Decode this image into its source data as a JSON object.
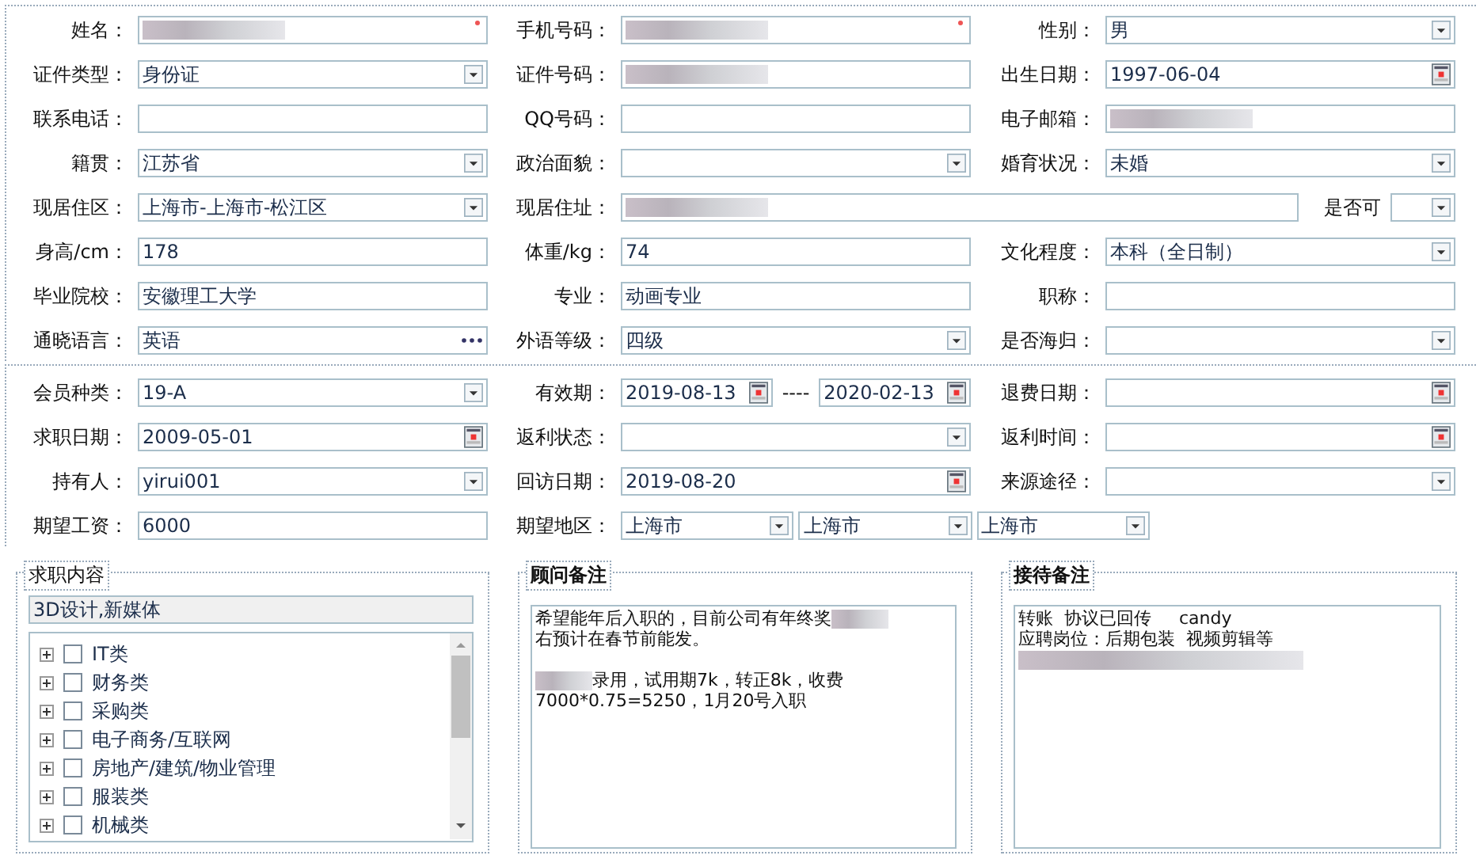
{
  "basic_rows": [
    {
      "kind": "triple",
      "items": [
        {
          "label": "姓名：",
          "controls": [
            {
              "kind": "text",
              "redacted": true,
              "required": true
            }
          ]
        },
        {
          "label": "手机号码：",
          "controls": [
            {
              "kind": "text",
              "redacted": true,
              "required": true
            }
          ]
        },
        {
          "label": "性别：",
          "controls": [
            {
              "kind": "select",
              "value": "男"
            }
          ]
        }
      ]
    },
    {
      "kind": "triple",
      "items": [
        {
          "label": "证件类型：",
          "controls": [
            {
              "kind": "select",
              "value": "身份证"
            }
          ]
        },
        {
          "label": "证件号码：",
          "controls": [
            {
              "kind": "text",
              "redacted": true
            }
          ]
        },
        {
          "label": "出生日期：",
          "controls": [
            {
              "kind": "date",
              "value": "1997-06-04"
            }
          ]
        }
      ]
    },
    {
      "kind": "triple",
      "items": [
        {
          "label": "联系电话：",
          "controls": [
            {
              "kind": "text"
            }
          ]
        },
        {
          "label": "QQ号码：",
          "controls": [
            {
              "kind": "text"
            }
          ]
        },
        {
          "label": "电子邮箱：",
          "controls": [
            {
              "kind": "text",
              "redacted": true
            }
          ]
        }
      ]
    },
    {
      "kind": "triple",
      "items": [
        {
          "label": "籍贯：",
          "controls": [
            {
              "kind": "select",
              "value": "江苏省"
            }
          ]
        },
        {
          "label": "政治面貌：",
          "controls": [
            {
              "kind": "select"
            }
          ]
        },
        {
          "label": "婚育状况：",
          "controls": [
            {
              "kind": "select",
              "value": "未婚"
            }
          ]
        }
      ]
    },
    {
      "kind": "wide",
      "items": [
        {
          "label": "现居住区：",
          "controls": [
            {
              "kind": "select",
              "value": "上海市-上海市-松江区"
            }
          ]
        },
        {
          "label": "现居住址：",
          "controls": [
            {
              "kind": "text",
              "redacted": true
            }
          ]
        },
        {
          "label": "是否可",
          "controls": [
            {
              "kind": "select"
            }
          ]
        }
      ]
    },
    {
      "kind": "triple",
      "items": [
        {
          "label": "身高/cm：",
          "controls": [
            {
              "kind": "text",
              "value": "178"
            }
          ]
        },
        {
          "label": "体重/kg：",
          "controls": [
            {
              "kind": "text",
              "value": "74"
            }
          ]
        },
        {
          "label": "文化程度：",
          "controls": [
            {
              "kind": "select",
              "value": "本科（全日制）"
            }
          ]
        }
      ]
    },
    {
      "kind": "triple",
      "items": [
        {
          "label": "毕业院校：",
          "controls": [
            {
              "kind": "text",
              "value": "安徽理工大学"
            }
          ]
        },
        {
          "label": "专业：",
          "controls": [
            {
              "kind": "text",
              "value": "动画专业"
            }
          ]
        },
        {
          "label": "职称：",
          "controls": [
            {
              "kind": "text"
            }
          ]
        }
      ]
    },
    {
      "kind": "triple",
      "items": [
        {
          "label": "通晓语言：",
          "controls": [
            {
              "kind": "lookup",
              "value": "英语"
            }
          ]
        },
        {
          "label": "外语等级：",
          "controls": [
            {
              "kind": "select",
              "value": "四级"
            }
          ]
        },
        {
          "label": "是否海归：",
          "controls": [
            {
              "kind": "select"
            }
          ]
        }
      ]
    }
  ],
  "member_rows": [
    {
      "kind": "triple",
      "items": [
        {
          "label": "会员种类：",
          "controls": [
            {
              "kind": "select",
              "value": "19-A"
            }
          ]
        },
        {
          "label": "有效期：",
          "controls": [
            {
              "kind": "date",
              "value": "2019-08-13"
            },
            {
              "kind": "dash",
              "value": "----"
            },
            {
              "kind": "date",
              "value": "2020-02-13"
            }
          ]
        },
        {
          "label": "退费日期：",
          "controls": [
            {
              "kind": "date"
            }
          ]
        }
      ]
    },
    {
      "kind": "triple",
      "items": [
        {
          "label": "求职日期：",
          "controls": [
            {
              "kind": "date",
              "value": "2009-05-01"
            }
          ]
        },
        {
          "label": "返利状态：",
          "controls": [
            {
              "kind": "select"
            }
          ]
        },
        {
          "label": "返利时间：",
          "controls": [
            {
              "kind": "date"
            }
          ]
        }
      ]
    },
    {
      "kind": "triple",
      "items": [
        {
          "label": "持有人：",
          "controls": [
            {
              "kind": "select",
              "value": "yirui001"
            }
          ]
        },
        {
          "label": "回访日期：",
          "controls": [
            {
              "kind": "date",
              "value": "2019-08-20"
            }
          ]
        },
        {
          "label": "来源途径：",
          "controls": [
            {
              "kind": "select"
            }
          ]
        }
      ]
    },
    {
      "kind": "region",
      "items": [
        {
          "label": "期望工资：",
          "controls": [
            {
              "kind": "text",
              "value": "6000"
            }
          ]
        },
        {
          "label": "期望地区：",
          "controls": [
            {
              "kind": "select",
              "value": "上海市"
            },
            {
              "kind": "select",
              "value": "上海市"
            },
            {
              "kind": "select",
              "value": "上海市"
            }
          ]
        }
      ]
    }
  ],
  "job_content": {
    "legend": "求职内容",
    "selection": "3D设计,新媒体",
    "categories": [
      {
        "label": "IT类",
        "checked": false
      },
      {
        "label": "财务类",
        "checked": false
      },
      {
        "label": "采购类",
        "checked": false
      },
      {
        "label": "电子商务/互联网",
        "checked": false
      },
      {
        "label": "房地产/建筑/物业管理",
        "checked": false
      },
      {
        "label": "服装类",
        "checked": false
      },
      {
        "label": "机械类",
        "checked": false
      }
    ]
  },
  "notes": [
    {
      "legend": "顾问备注",
      "paragraphs": [
        [
          {
            "kind": "text",
            "text": "希望能年后入职的，目前公司有年终奖"
          },
          {
            "kind": "redacted"
          },
          {
            "kind": "text",
            "text": "右预计在春节前能发。"
          }
        ],
        [
          {
            "kind": "redacted"
          },
          {
            "kind": "text",
            "text": "录用，试用期7k，转正8k，收费"
          },
          {
            "kind": "text",
            "text": "7000*0.75=5250，1月20号入职"
          }
        ]
      ]
    },
    {
      "legend": "接待备注",
      "paragraphs": [
        [
          {
            "kind": "text",
            "text": "转账  协议已回传     candy"
          }
        ],
        [
          {
            "kind": "text",
            "text": "应聘岗位：后期包装  视频剪辑等"
          }
        ],
        [
          {
            "kind": "redacted"
          }
        ]
      ]
    }
  ]
}
